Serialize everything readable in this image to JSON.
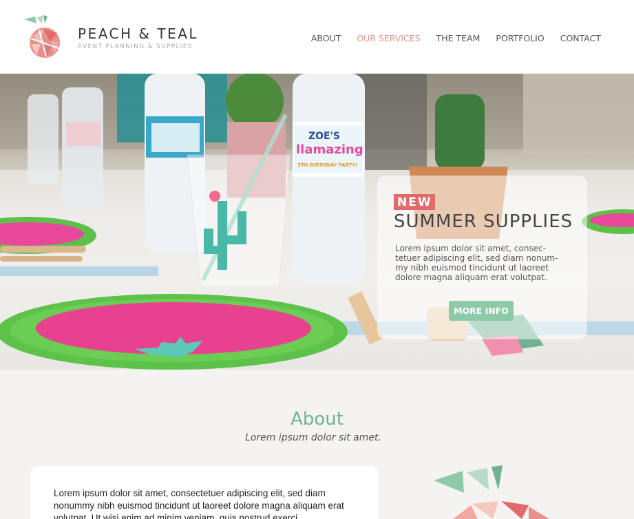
{
  "header": {
    "brand_name": "PEACH & TEAL",
    "brand_tagline": "EVENT PLANNING & SUPPLIES",
    "nav": [
      {
        "label": "ABOUT",
        "active": false
      },
      {
        "label": "OUR SERVICES",
        "active": true
      },
      {
        "label": "THE TEAM",
        "active": false
      },
      {
        "label": "PORTFOLIO",
        "active": false
      },
      {
        "label": "CONTACT",
        "active": false
      }
    ]
  },
  "hero": {
    "bottle_label_name": "ZOE'S",
    "bottle_label_title": "llamazing",
    "bottle_label_sub": "5TH BIRTHDAY PARTY!",
    "badge": "NEW",
    "title": "SUMMER SUPPLIES",
    "body": "Lorem ipsum dolor sit amet, consec-tetuer adipiscing elit, sed diam nonum-my nibh euismod tincidunt ut laoreet dolore magna aliquam erat volutpat.",
    "button": "MORE INFO"
  },
  "about": {
    "title": "About",
    "subtitle": "Lorem ipsum dolor sit amet.",
    "body": "Lorem ipsum dolor sit amet, consectetuer adipiscing elit, sed diam nonummy nibh euismod tincidunt ut laoreet dolore magna aliquam erat volutpat. Ut wisi enim ad minim veniam, quis nostrud exerci"
  },
  "colors": {
    "accent_peach": "#e8918c",
    "accent_teal": "#8ccaa8",
    "badge_red": "#e26a6a",
    "about_green": "#6fb293"
  },
  "icons": [
    "peach-logo-icon"
  ]
}
